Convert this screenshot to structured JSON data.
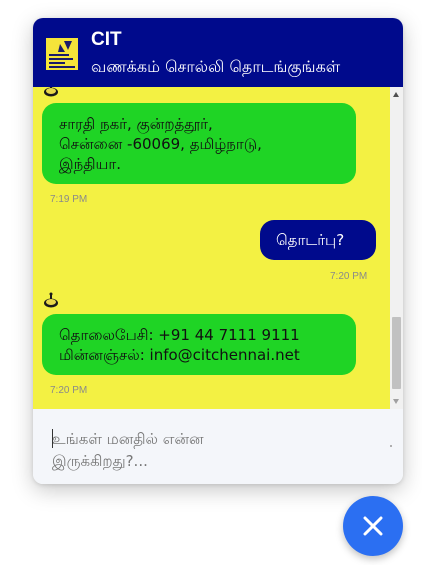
{
  "header": {
    "title": "CIT",
    "subtitle": "வணக்கம் சொல்லி தொடங்குங்கள்",
    "logo_icon": "cit-logo-icon"
  },
  "colors": {
    "header_bg": "#000a8c",
    "chat_bg": "#f3f143",
    "bot_bubble": "#1fd425",
    "user_bubble": "#000a8c",
    "fab": "#2b6ff2"
  },
  "messages": [
    {
      "sender": "bot",
      "lines": [
        "சாரதி நகர், குன்றத்தூர்,",
        "சென்னை -60069, தமிழ்நாடு,",
        "இந்தியா."
      ],
      "time": "7:19 PM"
    },
    {
      "sender": "user",
      "lines": [
        "தொடர்பு?"
      ],
      "time": "7:20 PM"
    },
    {
      "sender": "bot",
      "lines": [
        "தொலைபேசி: +91 44 7111 9111",
        "மின்னஞ்சல்: info@citchennai.net"
      ],
      "time": "7:20 PM"
    }
  ],
  "input": {
    "placeholder_lines": [
      "உங்கள் மனதில் என்ன",
      "இருக்கிறது?..."
    ]
  },
  "fab": {
    "icon": "close-icon"
  },
  "bot_avatar_icon": "bot-avatar-icon"
}
